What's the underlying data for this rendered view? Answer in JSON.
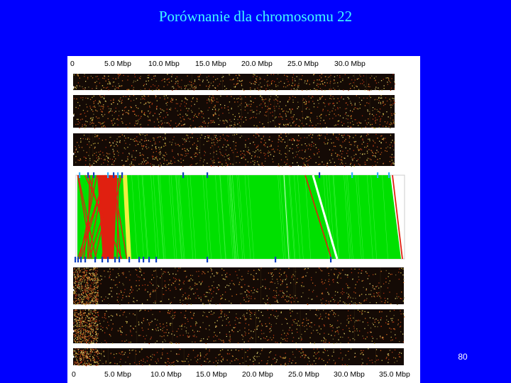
{
  "slide": {
    "title": "Porównanie dla chromosomu 22",
    "page_number": "80"
  },
  "figure": {
    "top_axis_labels": [
      "0",
      "5.0 Mbp",
      "10.0 Mbp",
      "15.0 Mbp",
      "20.0 Mbp",
      "25.0 Mbp",
      "30.0 Mbp"
    ],
    "bottom_axis_labels": [
      "0",
      "5.0 Mbp",
      "10.0 Mbp",
      "15.0 Mbp",
      "20.0 Mbp",
      "25.0 Mbp",
      "30.0 Mbp",
      "35.0 Mbp"
    ],
    "colors": {
      "track_background": "#140a05",
      "synteny_forward": "#00e000",
      "synteny_reverse": "#e02010",
      "marker": "#1040c0",
      "marker_light": "#30b0ff"
    }
  }
}
